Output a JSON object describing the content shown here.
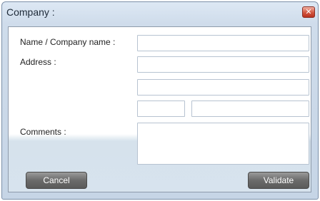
{
  "window": {
    "title": "Company :"
  },
  "form": {
    "name_label": "Name / Company name :",
    "address_label": "Address :",
    "comments_label": "Comments :",
    "name_value": "",
    "address_line1": "",
    "address_line2": "",
    "postal_code": "",
    "city": "",
    "comments_value": ""
  },
  "buttons": {
    "cancel": "Cancel",
    "validate": "Validate"
  },
  "icons": {
    "close": "close-icon"
  }
}
